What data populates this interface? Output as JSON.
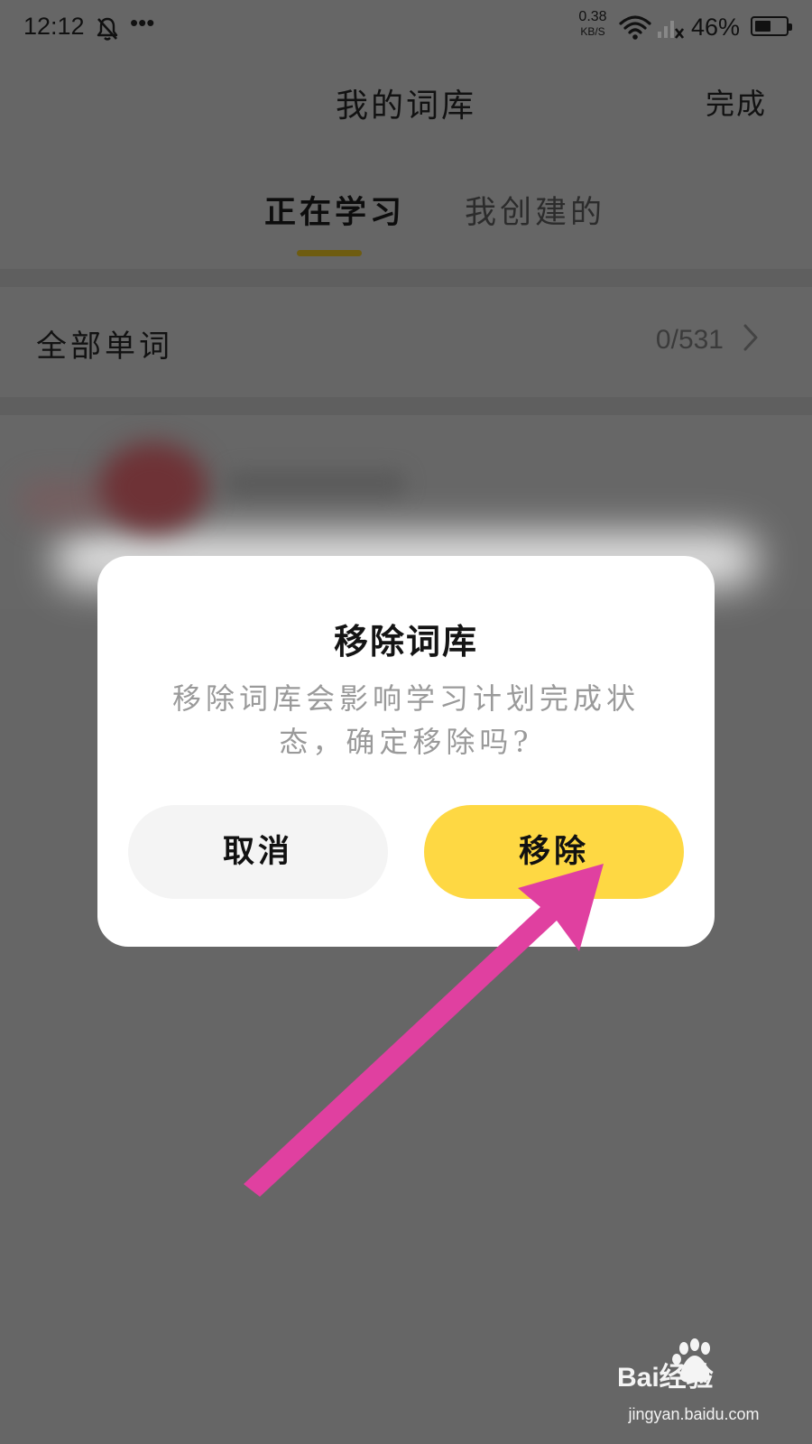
{
  "status_bar": {
    "time": "12:12",
    "more_dots": "•••",
    "net_speed_value": "0.38",
    "net_speed_unit": "KB/S",
    "battery_percent": "46%"
  },
  "header": {
    "title": "我的词库",
    "done_label": "完成"
  },
  "tabs": [
    {
      "label": "正在学习",
      "active": true
    },
    {
      "label": "我创建的",
      "active": false
    }
  ],
  "list": {
    "all_words_label": "全部单词",
    "all_words_count": "0/531"
  },
  "dialog": {
    "title": "移除词库",
    "message": "移除词库会影响学习计划完成状态，确定移除吗?",
    "cancel_label": "取消",
    "remove_label": "移除"
  },
  "watermark": {
    "logo_text": "Bai经验",
    "url": "jingyan.baidu.com"
  },
  "colors": {
    "overlay_bg": "#666666",
    "dialog_bg": "#ffffff",
    "remove_button": "#fed843",
    "cancel_button": "#f4f4f4",
    "tab_indicator": "#6e5c10",
    "annotation_arrow": "#e040a0"
  },
  "icons": {
    "notifications_muted": "bell-off-icon",
    "wifi": "wifi-icon",
    "signal": "signal-off-icon",
    "battery": "battery-icon",
    "chevron": "chevron-right-icon",
    "annotation": "pointer-arrow-icon"
  }
}
